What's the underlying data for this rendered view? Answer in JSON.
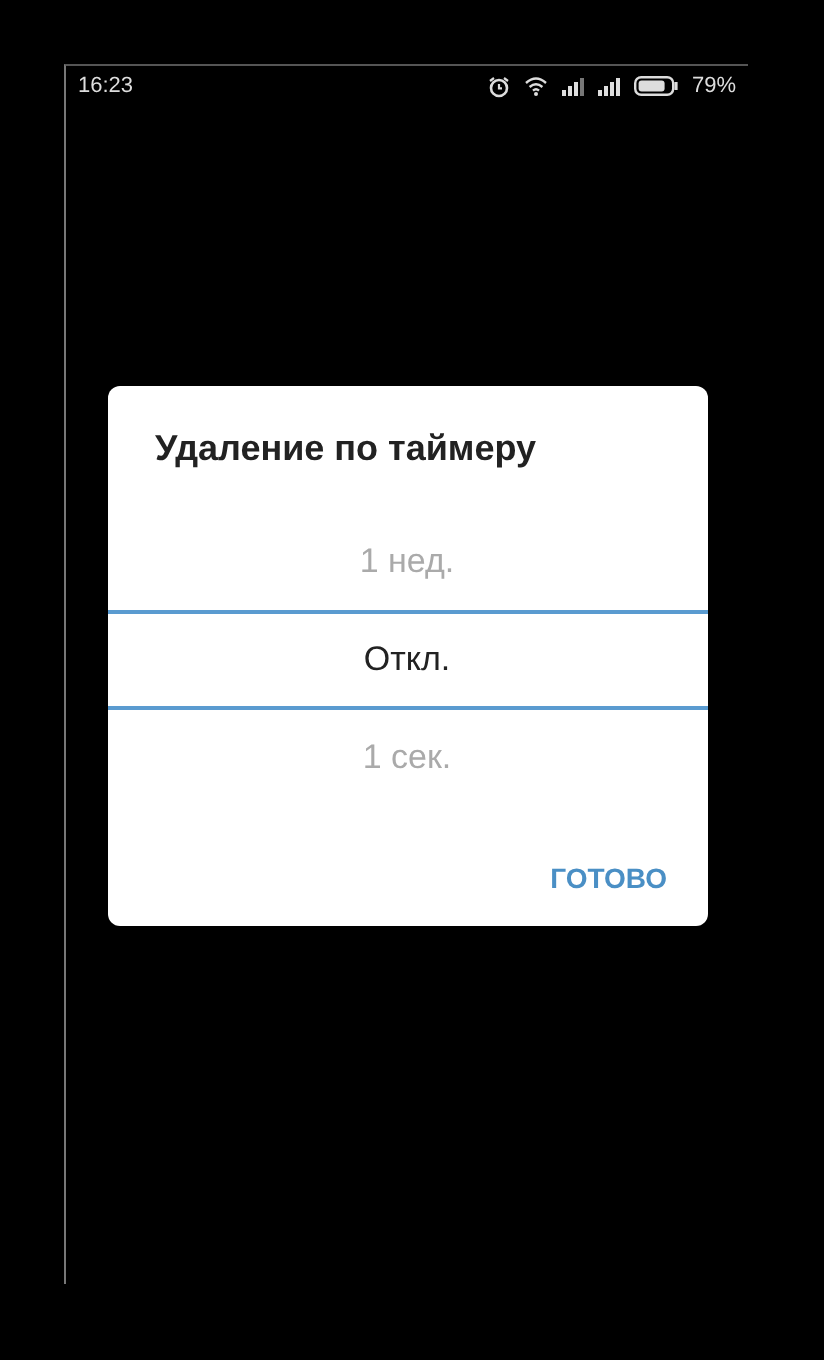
{
  "status_bar": {
    "time": "16:23",
    "battery": "79%"
  },
  "dialog": {
    "title": "Удаление по таймеру",
    "picker": [
      {
        "label": "1 нед.",
        "selected": false
      },
      {
        "label": "Откл.",
        "selected": true
      },
      {
        "label": "1 сек.",
        "selected": false
      }
    ],
    "button": "ГОТОВО"
  }
}
